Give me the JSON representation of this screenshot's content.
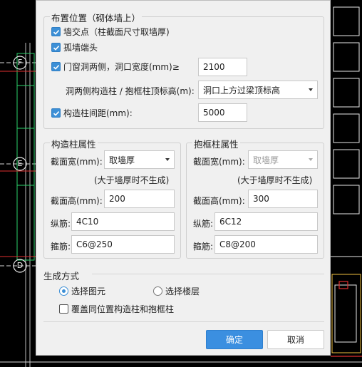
{
  "colors": {
    "accent": "#3b8fe0",
    "dialog_bg": "#f0f0f0",
    "cad_bg": "#000000"
  },
  "layout_group": {
    "title": "布置位置（砌体墙上）",
    "wall_intersection": {
      "label": "墙交点（柱截面尺寸取墙厚)",
      "checked": true
    },
    "isolated_wall_end": {
      "label": "孤墙端头",
      "checked": true
    },
    "door_window_sides": {
      "label": "门窗洞两侧，洞口宽度(mm)≥",
      "checked": true,
      "value": "2100"
    },
    "side_top_elev": {
      "label": "洞两侧构造柱 / 抱框柱顶标高(m):",
      "value": "洞口上方过梁顶标高"
    },
    "spacing": {
      "label": "构造柱间距(mm):",
      "checked": true,
      "value": "5000"
    }
  },
  "constructional_column": {
    "title": "构造柱属性",
    "width_label": "截面宽(mm):",
    "width_value": "取墙厚",
    "note": "(大于墙厚时不生成)",
    "height_label": "截面高(mm):",
    "height_value": "200",
    "long_bar_label": "纵筋:",
    "long_bar_value": "4C10",
    "stirrup_label": "箍筋:",
    "stirrup_value": "C6@250"
  },
  "frame_column": {
    "title": "抱框柱属性",
    "width_label": "截面宽(mm):",
    "width_value": "取墙厚",
    "note": "(大于墙厚时不生成)",
    "height_label": "截面高(mm):",
    "height_value": "300",
    "long_bar_label": "纵筋:",
    "long_bar_value": "6C12",
    "stirrup_label": "箍筋:",
    "stirrup_value": "C8@200"
  },
  "generation": {
    "title": "生成方式",
    "option_select_element": "选择图元",
    "option_select_floor": "选择楼层",
    "selected": "选择图元",
    "overwrite": {
      "label": "覆盖同位置构造柱和抱框柱",
      "checked": false
    }
  },
  "buttons": {
    "ok": "确定",
    "cancel": "取消"
  },
  "cad": {
    "axis_labels": [
      "F",
      "E",
      "D"
    ]
  }
}
